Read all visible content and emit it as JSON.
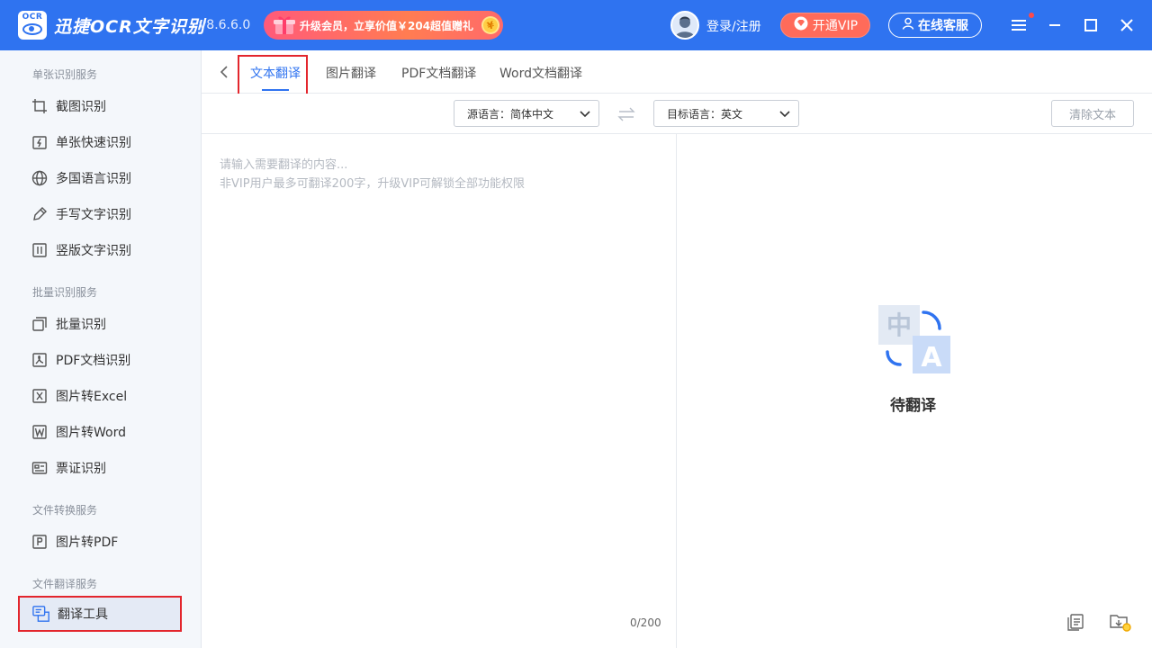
{
  "app": {
    "logo_text": "OCR",
    "title": "迅捷OCR文字识别",
    "version": "v8.6.6.0",
    "promo_text": "升级会员，立享价值￥204超值赠礼",
    "login_label": "登录/注册",
    "vip_label": "开通VIP",
    "service_label": "在线客服",
    "brand_color": "#2f73f0"
  },
  "sidebar": {
    "sections": [
      {
        "title": "单张识别服务"
      },
      {
        "title": "批量识别服务"
      },
      {
        "title": "文件转换服务"
      },
      {
        "title": "文件翻译服务"
      }
    ],
    "items": [
      {
        "label": "截图识别",
        "icon": "crop-icon"
      },
      {
        "label": "单张快速识别",
        "icon": "quick-scan-icon"
      },
      {
        "label": "多国语言识别",
        "icon": "globe-icon"
      },
      {
        "label": "手写文字识别",
        "icon": "pen-icon"
      },
      {
        "label": "竖版文字识别",
        "icon": "vertical-text-icon"
      },
      {
        "label": "批量识别",
        "icon": "batch-icon"
      },
      {
        "label": "PDF文档识别",
        "icon": "pdf-icon"
      },
      {
        "label": "图片转Excel",
        "icon": "excel-icon"
      },
      {
        "label": "图片转Word",
        "icon": "word-icon"
      },
      {
        "label": "票证识别",
        "icon": "ticket-icon"
      },
      {
        "label": "图片转PDF",
        "icon": "image-to-pdf-icon"
      },
      {
        "label": "翻译工具",
        "icon": "translate-tool-icon",
        "active": true
      }
    ]
  },
  "tabs": [
    {
      "label": "文本翻译",
      "active": true
    },
    {
      "label": "图片翻译"
    },
    {
      "label": "PDF文档翻译"
    },
    {
      "label": "Word文档翻译"
    }
  ],
  "toolbar": {
    "source_lang": "源语言：简体中文",
    "target_lang": "目标语言：英文",
    "clear_label": "清除文本"
  },
  "input": {
    "placeholder_line1": "请输入需要翻译的内容...",
    "placeholder_line2": "非VIP用户最多可翻译200字，升级VIP可解锁全部功能权限",
    "counter": "0/200"
  },
  "output": {
    "empty_label": "待翻译"
  }
}
